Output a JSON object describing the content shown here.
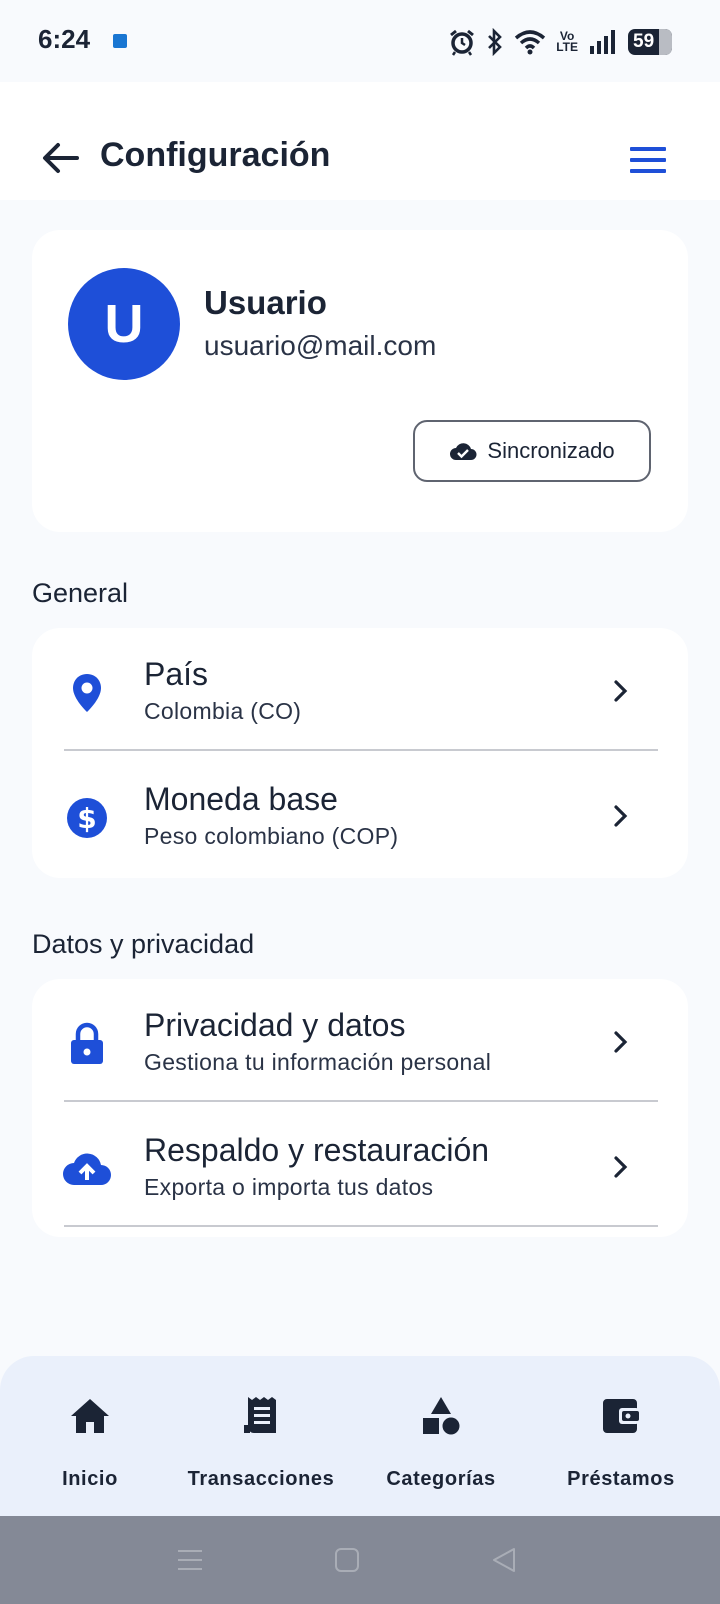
{
  "status_bar": {
    "time": "6:24",
    "battery": "59",
    "icons": [
      "alarm-icon",
      "bluetooth-icon",
      "wifi-icon",
      "volte-icon",
      "signal-icon",
      "battery-icon"
    ],
    "volte_top": "Vo",
    "volte_bottom": "LTE"
  },
  "header": {
    "title": "Configuración",
    "back_icon": "arrow-left-icon",
    "menu_icon": "hamburger-menu-icon"
  },
  "profile": {
    "avatar_letter": "U",
    "name": "Usuario",
    "email": "usuario@mail.com",
    "sync_label": "Sincronizado"
  },
  "sections": {
    "general": {
      "title": "General",
      "items": [
        {
          "title": "País",
          "subtitle": "Colombia (CO)",
          "icon": "location-pin-icon"
        },
        {
          "title": "Moneda base",
          "subtitle": "Peso colombiano (COP)",
          "icon": "dollar-icon"
        }
      ]
    },
    "privacy": {
      "title": "Datos y privacidad",
      "items": [
        {
          "title": "Privacidad y datos",
          "subtitle": "Gestiona tu información personal",
          "icon": "lock-icon"
        },
        {
          "title": "Respaldo y restauración",
          "subtitle": "Exporta o importa tus datos",
          "icon": "cloud-upload-icon"
        }
      ]
    }
  },
  "bottom_nav": {
    "items": [
      {
        "label": "Inicio",
        "icon": "home-icon"
      },
      {
        "label": "Transacciones",
        "icon": "receipt-icon"
      },
      {
        "label": "Categorías",
        "icon": "shapes-icon"
      },
      {
        "label": "Préstamos",
        "icon": "wallet-icon"
      }
    ]
  },
  "colors": {
    "accent": "#1e4fd8",
    "text": "#1b2435",
    "background": "#f8fafd",
    "nav_background": "#eaf0fb",
    "system_nav": "#848996"
  }
}
